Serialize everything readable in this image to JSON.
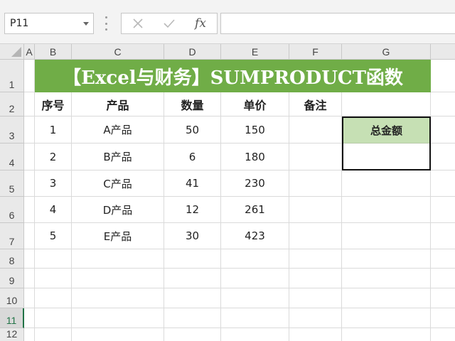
{
  "formula_bar": {
    "name_box": "P11",
    "cancel_icon": "close-icon",
    "enter_icon": "check-icon",
    "fx_label": "fx",
    "formula": ""
  },
  "columns": [
    "A",
    "B",
    "C",
    "D",
    "E",
    "F",
    "G"
  ],
  "rows": [
    "1",
    "2",
    "3",
    "4",
    "5",
    "6",
    "7",
    "8",
    "9",
    "10",
    "11",
    "12"
  ],
  "active_row": "11",
  "title": "【Excel与财务】SUMPRODUCT函数",
  "table": {
    "headers": [
      "序号",
      "产品",
      "数量",
      "单价",
      "备注"
    ],
    "rows": [
      [
        "1",
        "A产品",
        "50",
        "150",
        ""
      ],
      [
        "2",
        "B产品",
        "6",
        "180",
        ""
      ],
      [
        "3",
        "C产品",
        "41",
        "230",
        ""
      ],
      [
        "4",
        "D产品",
        "12",
        "261",
        ""
      ],
      [
        "5",
        "E产品",
        "30",
        "423",
        ""
      ]
    ]
  },
  "total": {
    "label": "总金额",
    "value": ""
  },
  "colors": {
    "title_bg": "#70ad47",
    "total_header_bg": "#c6e0b4",
    "active_row_accent": "#217346"
  }
}
